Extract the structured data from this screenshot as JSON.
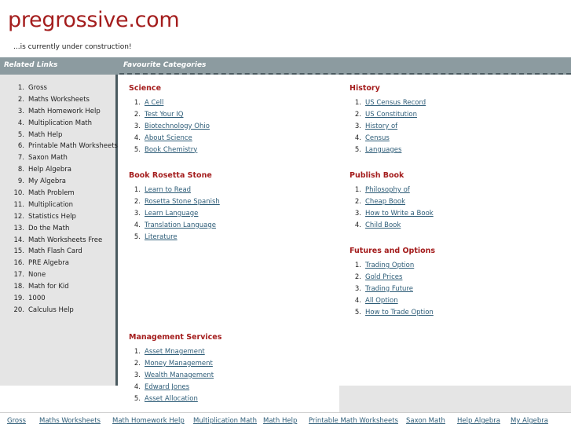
{
  "site": {
    "title": "pregrossive.com",
    "tagline": "...is currently under construction!"
  },
  "sidebar": {
    "header": "Related Links",
    "items": [
      {
        "num": "1.",
        "label": "Gross"
      },
      {
        "num": "2.",
        "label": "Maths Worksheets"
      },
      {
        "num": "3.",
        "label": "Math Homework Help"
      },
      {
        "num": "4.",
        "label": "Multiplication Math"
      },
      {
        "num": "5.",
        "label": "Math Help"
      },
      {
        "num": "6.",
        "label": "Printable Math Worksheets"
      },
      {
        "num": "7.",
        "label": "Saxon Math"
      },
      {
        "num": "8.",
        "label": "Help Algebra"
      },
      {
        "num": "9.",
        "label": "My Algebra"
      },
      {
        "num": "10.",
        "label": "Math Problem"
      },
      {
        "num": "11.",
        "label": "Multiplication"
      },
      {
        "num": "12.",
        "label": "Statistics Help"
      },
      {
        "num": "13.",
        "label": "Do the Math"
      },
      {
        "num": "14.",
        "label": "Math Worksheets Free"
      },
      {
        "num": "15.",
        "label": "Math Flash Card"
      },
      {
        "num": "16.",
        "label": "PRE Algebra"
      },
      {
        "num": "17.",
        "label": "None"
      },
      {
        "num": "18.",
        "label": "Math for Kid"
      },
      {
        "num": "19.",
        "label": "1000"
      },
      {
        "num": "20.",
        "label": "Calculus Help"
      }
    ]
  },
  "main": {
    "header": "Favourite Categories",
    "categories": [
      {
        "title": "Science",
        "links": [
          "A Cell",
          "Test Your IQ",
          "Biotechnology Ohio",
          "About Science",
          "Book Chemistry"
        ]
      },
      {
        "title": "History",
        "links": [
          "US Census Record",
          "US Constitution",
          "History of",
          "Census",
          "Languages"
        ]
      },
      {
        "title": "Book Rosetta Stone",
        "links": [
          "Learn to Read",
          "Rosetta Stone Spanish",
          "Learn Language",
          "Translation Language",
          "Literature"
        ]
      },
      {
        "title": "Publish Book",
        "links": [
          "Philosophy of",
          "Cheap Book",
          "How to Write a Book",
          "Child Book"
        ]
      },
      {
        "title": "Futures and Options",
        "links": [
          "Trading Option",
          "Gold Prices",
          "Trading Future",
          "All Option",
          "How to Trade Option"
        ]
      },
      {
        "title": "Management Services",
        "links": [
          "Asset Mnagement",
          "Money Management",
          "Wealth Management",
          "Edward Jones",
          "Asset Allocation"
        ]
      }
    ]
  },
  "footer": {
    "links": [
      "Gross",
      "Maths Worksheets",
      "Math Homework Help",
      "Multiplication Math",
      "Math Help",
      "Printable Math Worksheets",
      "Saxon Math",
      "Help Algebra",
      "My Algebra"
    ]
  },
  "colors": {
    "title": "#a41d1d",
    "bar": "#8c9ba0",
    "sidebar_bg": "#e5e5e5",
    "link": "#2e5d78"
  }
}
